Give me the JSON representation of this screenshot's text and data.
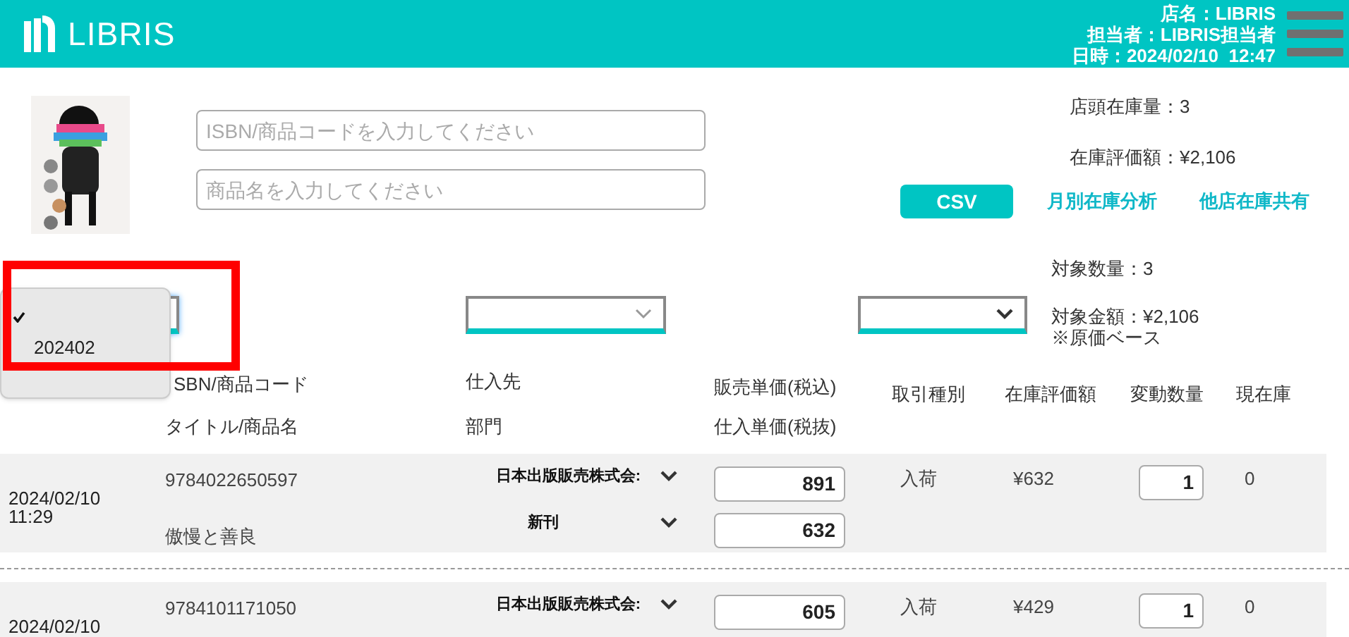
{
  "header": {
    "logo": "LIBRIS",
    "info": [
      "店名：LIBRIS",
      "担当者：LIBRIS担当者",
      "日時：2024/02/10  12:47"
    ]
  },
  "cover": {
    "kind": "picture"
  },
  "search": [
    {
      "placeholder": "ISBN/商品コードを入力してください"
    },
    {
      "placeholder": "商品名を入力してください"
    }
  ],
  "summary": [
    "店頭在庫量：3",
    "在庫評価額：¥2,106"
  ],
  "actions": [
    {
      "label": "CSV",
      "kind": "primary"
    },
    {
      "label": "月別在庫分析",
      "kind": "link"
    },
    {
      "label": "他店在庫共有",
      "kind": "link"
    }
  ],
  "filters": [
    {
      "open": true,
      "options": [
        {
          "selected": true
        },
        {
          "label": "202402",
          "selected": false
        }
      ]
    },
    {
      "open": false
    },
    {
      "open": false
    }
  ],
  "target": {
    "count": "対象数量：3",
    "amount": "対象金額：¥2,106",
    "note": "※原価ベース"
  },
  "columns": {
    "code": "SBN/商品コード",
    "title": "タイトル/商品名",
    "supplier": "仕入先",
    "department": "部門",
    "sale": "販売単価(税込)",
    "cost": "仕入単価(税抜)",
    "type": "取引種別",
    "value": "在庫評価額",
    "qty": "変動数量",
    "stock": "現在庫"
  },
  "rows": [
    {
      "date": "2024/02/10",
      "time": "11:29",
      "isbn": "9784022650597",
      "title": "傲慢と善良",
      "supplier": "日本出版販売株式会:",
      "department": "新刊",
      "sale_price": "891",
      "cost_price": "632",
      "type": "入荷",
      "value": "¥632",
      "qty": "1",
      "stock": "0"
    },
    {
      "date": "2024/02/10",
      "isbn": "9784101171050",
      "supplier": "日本出版販売株式会:",
      "sale_price": "605",
      "type": "入荷",
      "value": "¥429",
      "qty": "1",
      "stock": "0"
    }
  ]
}
